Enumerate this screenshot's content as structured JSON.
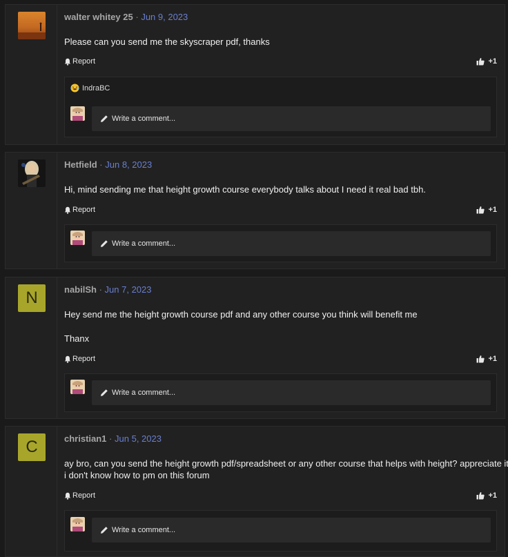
{
  "labels": {
    "report": "Report",
    "comment_placeholder": "Write a comment...",
    "separator": "·"
  },
  "colors": {
    "page_bg": "#1a1a1a",
    "post_bg": "#212121",
    "date_link": "#6a7fd0",
    "letter_avatar": "#a8a62a"
  },
  "posts": [
    {
      "username": "walter whitey 25",
      "date": "Jun 9, 2023",
      "avatar": {
        "kind": "image",
        "icon": "desert-figure-photo"
      },
      "body": [
        "Please can you send me the skyscraper pdf, thanks"
      ],
      "likes": "+1",
      "reactions": {
        "emoji_icon": "laughing-emoji-icon",
        "user": "IndraBC"
      }
    },
    {
      "username": "Hetfield",
      "date": "Jun 8, 2023",
      "avatar": {
        "kind": "image",
        "icon": "guitarist-photo"
      },
      "body": [
        "Hi, mind sending me that height growth course everybody talks about I need it real bad tbh."
      ],
      "likes": "+1"
    },
    {
      "username": "nabilSh",
      "date": "Jun 7, 2023",
      "avatar": {
        "kind": "letter",
        "letter": "N"
      },
      "body": [
        "Hey send me the height growth course pdf and any other course you think will benefit me",
        "",
        "Thanx"
      ],
      "likes": "+1"
    },
    {
      "username": "christian1",
      "date": "Jun 5, 2023",
      "avatar": {
        "kind": "letter",
        "letter": "C"
      },
      "body": [
        "ay bro, can you send the height growth pdf/spreadsheet or any other course that helps with height? appreciate it.",
        "i don't know how to pm on this forum"
      ],
      "likes": "+1"
    }
  ]
}
